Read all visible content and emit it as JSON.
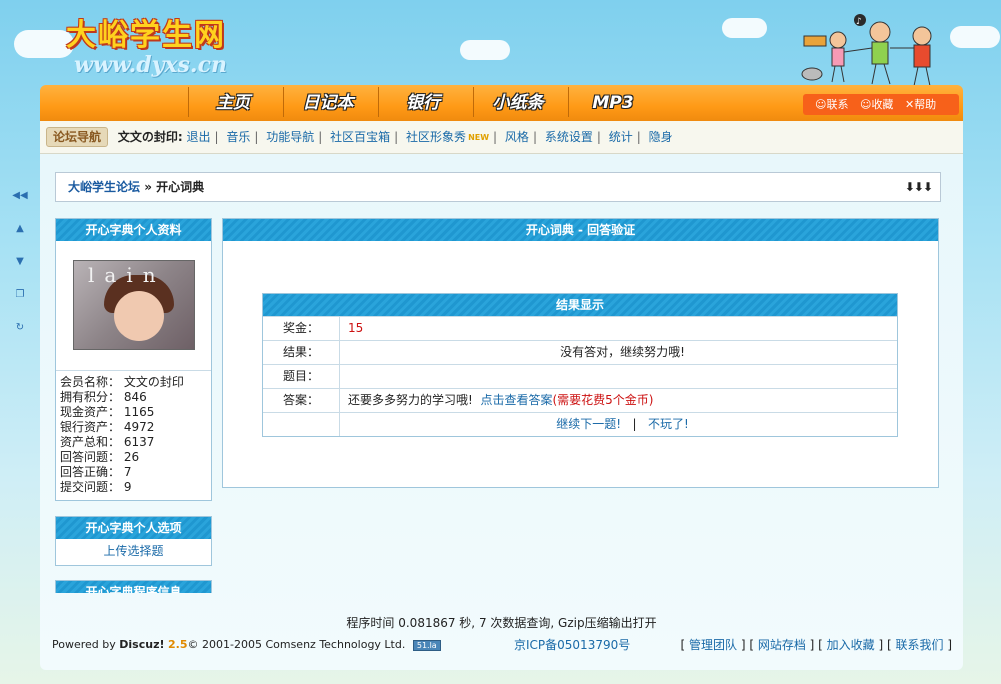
{
  "header": {
    "logo_cn": "大峪学生网",
    "logo_url": "www.dyxs.cn"
  },
  "nav": {
    "items": [
      "主页",
      "日记本",
      "银行",
      "小纸条",
      "MP3"
    ],
    "right": {
      "contact": "联系",
      "favorite": "收藏",
      "help": "帮助"
    }
  },
  "subbar": {
    "tag": "论坛导航",
    "user": "文文の封印:",
    "links": [
      "退出",
      "音乐",
      "功能导航",
      "社区百宝箱",
      "社区形象秀",
      "风格",
      "系统设置",
      "统计",
      "隐身"
    ],
    "new_badge": "NEW"
  },
  "breadcrumb": {
    "forum": "大峪学生论坛",
    "sep": " » ",
    "page": "开心词典",
    "arrows": "⬇⬇⬇"
  },
  "profile": {
    "title": "开心字典个人资料",
    "avatar_text": "lain",
    "fields": [
      {
        "label": "会员名称：",
        "value": "文文の封印"
      },
      {
        "label": "拥有积分：",
        "value": "846"
      },
      {
        "label": "现金资产：",
        "value": "1165"
      },
      {
        "label": "银行资产：",
        "value": "4972"
      },
      {
        "label": "资产总和：",
        "value": "6137"
      },
      {
        "label": "回答问题：",
        "value": "26"
      },
      {
        "label": "回答正确：",
        "value": "7"
      },
      {
        "label": "提交问题：",
        "value": "9"
      }
    ]
  },
  "options": {
    "title": "开心字典个人选项",
    "upload": "上传选择题"
  },
  "program_info": {
    "title": "开心字典程序信息"
  },
  "main": {
    "title": "开心词典 - 回答验证",
    "result_title": "结果显示",
    "rows": {
      "bonus_label": "奖金：",
      "bonus_value": "15",
      "result_label": "结果：",
      "result_value": "没有答对，继续努力哦!",
      "question_label": "题目：",
      "question_value": "",
      "answer_label": "答案：",
      "answer_text": "还要多多努力的学习哦!",
      "answer_link": "点击查看答案",
      "answer_cost": "(需要花费5个金币)"
    },
    "next": "继续下一题!",
    "divider": "|",
    "quit": "不玩了!"
  },
  "footer": {
    "time": "程序时间 0.081867 秒, 7 次数据查询, Gzip压缩输出打开",
    "powered": "Powered by",
    "brand": "Discuz!",
    "version": "2.5",
    "copyright": "© 2001-2005 Comsenz Technology Ltd.",
    "stat_badge": "51.la",
    "icp": "京ICP备05013790号",
    "links": [
      "管理团队",
      "网站存档",
      "加入收藏",
      "联系我们"
    ]
  },
  "colors": {
    "nav_orange": "#ff9a16",
    "panel_blue": "#1f97d0",
    "link_blue": "#1a6aa8",
    "red": "#cc1111"
  }
}
